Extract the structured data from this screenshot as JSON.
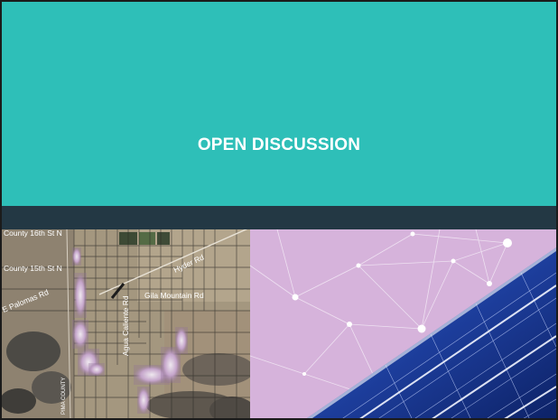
{
  "slide": {
    "title": "OPEN DISCUSSION"
  },
  "map": {
    "labels": {
      "county_16th": "County 16th St N",
      "county_15th": "County 15th St N",
      "palomas": "E Palomas Rd",
      "gila_mountain": "Gila Mountain Rd",
      "hyder": "Hyder Rd",
      "agua_caliente": "Agua Caliente Rd",
      "county_line": "PIMA COUNTY"
    }
  },
  "colors": {
    "teal": "#2ebfb8",
    "navy": "#233844",
    "lavender": "#d4b1d9",
    "solar_blue": "#1f3a93"
  }
}
